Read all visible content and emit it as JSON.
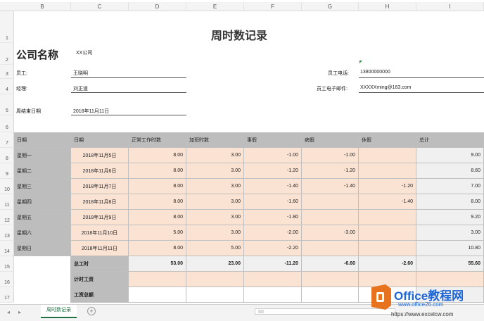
{
  "columns": [
    "B",
    "C",
    "D",
    "E",
    "F",
    "G",
    "H",
    "I"
  ],
  "rows": [
    "1",
    "2",
    "3",
    "4",
    "5",
    "6",
    "7",
    "8",
    "9",
    "10",
    "11",
    "12",
    "13",
    "14",
    "15",
    "16",
    "17"
  ],
  "title": "周时数记录",
  "company_label": "公司名称",
  "company_value": "XX公司",
  "employee_label": "员工:",
  "employee_value": "王晓明",
  "manager_label": "经理:",
  "manager_value": "刘正道",
  "week_end_label": "周结束日期",
  "week_end_value": "2018年11月11日",
  "phone_label": "员工电话:",
  "phone_value": "13800000000",
  "email_label": "员工电子邮件:",
  "email_value": "XXXXXming@163.com",
  "table": {
    "headers": [
      "日期",
      "日期",
      "正常工作时数",
      "加班时数",
      "事假",
      "病假",
      "休假",
      "总计"
    ],
    "rows": [
      [
        "星期一",
        "2018年11月5日",
        "8.00",
        "3.00",
        "-1.00",
        "-1.00",
        "",
        "9.00"
      ],
      [
        "星期二",
        "2018年11月6日",
        "8.00",
        "3.00",
        "-1.20",
        "-1.20",
        "",
        "8.60"
      ],
      [
        "星期三",
        "2018年11月7日",
        "8.00",
        "3.00",
        "-1.40",
        "-1.40",
        "-1.20",
        "7.00"
      ],
      [
        "星期四",
        "2018年11月8日",
        "8.00",
        "3.00",
        "-1.60",
        "",
        "-1.40",
        "8.00"
      ],
      [
        "星期五",
        "2018年11月9日",
        "8.00",
        "3.00",
        "-1.80",
        "",
        "",
        "9.20"
      ],
      [
        "星期六",
        "2018年11月10日",
        "5.00",
        "3.00",
        "-2.00",
        "-3.00",
        "",
        "3.00"
      ],
      [
        "星期日",
        "2018年11月11日",
        "8.00",
        "5.00",
        "-2.20",
        "",
        "",
        "10.80"
      ]
    ],
    "totals_label": "总工时",
    "totals": [
      "53.00",
      "23.00",
      "-11.20",
      "-6.60",
      "-2.60",
      "55.60"
    ],
    "wage_label": "计时工资",
    "total_wage_label": "工资总额"
  },
  "sheet_tab": "周时数记录",
  "add_sheet": "+",
  "watermark": {
    "brand": "Office教程网",
    "url1": "www.office26.com",
    "url2": "https://www.excelcw.com"
  },
  "colors": {
    "header_gray": "#bdbdbd",
    "peach": "#fbe3d4",
    "total_gray": "#f0f0f0",
    "tab_green": "#1e7145",
    "logo_orange": "#e8731f"
  }
}
